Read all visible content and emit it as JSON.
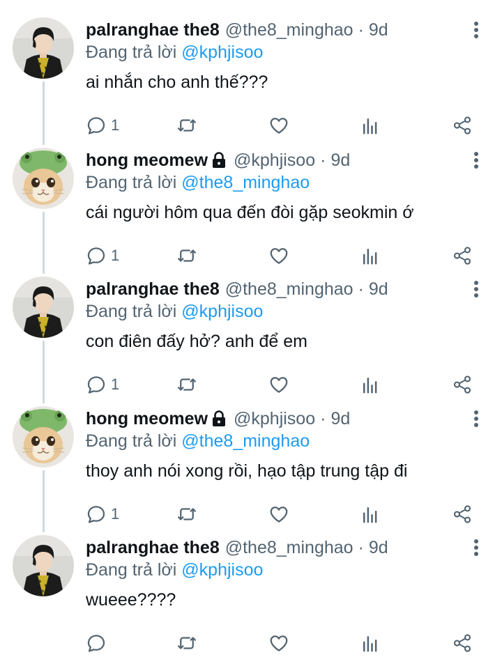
{
  "tweets": [
    {
      "name": "palranghae the8",
      "handle": "@the8_minghao",
      "time": "9d",
      "locked": false,
      "avatar": "man-avatar",
      "reply_prefix": "Đang trả lời",
      "reply_to": "@kphjisoo",
      "text": "ai nhắn cho anh thế???",
      "reply_count": "1"
    },
    {
      "name": "hong meomew",
      "handle": "@kphjisoo",
      "time": "9d",
      "locked": true,
      "avatar": "cat-avatar",
      "reply_prefix": "Đang trả lời",
      "reply_to": "@the8_minghao",
      "text": "cái người hôm qua đến đòi gặp seokmin ớ",
      "reply_count": "1"
    },
    {
      "name": "palranghae the8",
      "handle": "@the8_minghao",
      "time": "9d",
      "locked": false,
      "avatar": "man-avatar",
      "reply_prefix": "Đang trả lời",
      "reply_to": "@kphjisoo",
      "text": "con điên đấy hở? anh để em",
      "reply_count": "1"
    },
    {
      "name": "hong meomew",
      "handle": "@kphjisoo",
      "time": "9d",
      "locked": true,
      "avatar": "cat-avatar",
      "reply_prefix": "Đang trả lời",
      "reply_to": "@the8_minghao",
      "text": "thoy anh nói xong rồi, hạo tập trung tập đi",
      "reply_count": "1"
    },
    {
      "name": "palranghae the8",
      "handle": "@the8_minghao",
      "time": "9d",
      "locked": false,
      "avatar": "man-avatar",
      "reply_prefix": "Đang trả lời",
      "reply_to": "@kphjisoo",
      "text": "wueee????",
      "reply_count": ""
    }
  ],
  "icons": {
    "reply": "reply-icon",
    "retweet": "retweet-icon",
    "like": "heart-icon",
    "views": "analytics-icon",
    "share": "share-icon",
    "more": "more-vertical-icon",
    "lock": "lock-icon"
  },
  "colors": {
    "link": "#1d9bf0",
    "secondary": "#536471",
    "text": "#0f1419",
    "thread_line": "#cfd9de"
  }
}
